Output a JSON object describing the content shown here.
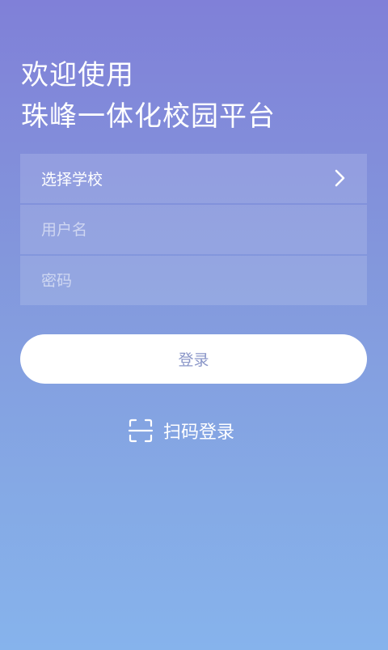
{
  "header": {
    "welcome_line": "欢迎使用",
    "platform_name": "珠峰一体化校园平台"
  },
  "form": {
    "school_select_label": "选择学校",
    "username_placeholder": "用户名",
    "password_placeholder": "密码"
  },
  "actions": {
    "login_label": "登录",
    "scan_login_label": "扫码登录"
  },
  "colors": {
    "gradient_top": "#8080d8",
    "gradient_bottom": "#86b3ec",
    "login_text": "#8a96c8"
  },
  "icons": {
    "school_select": "chevron-right-icon",
    "scan_login": "scan-qr-icon"
  }
}
